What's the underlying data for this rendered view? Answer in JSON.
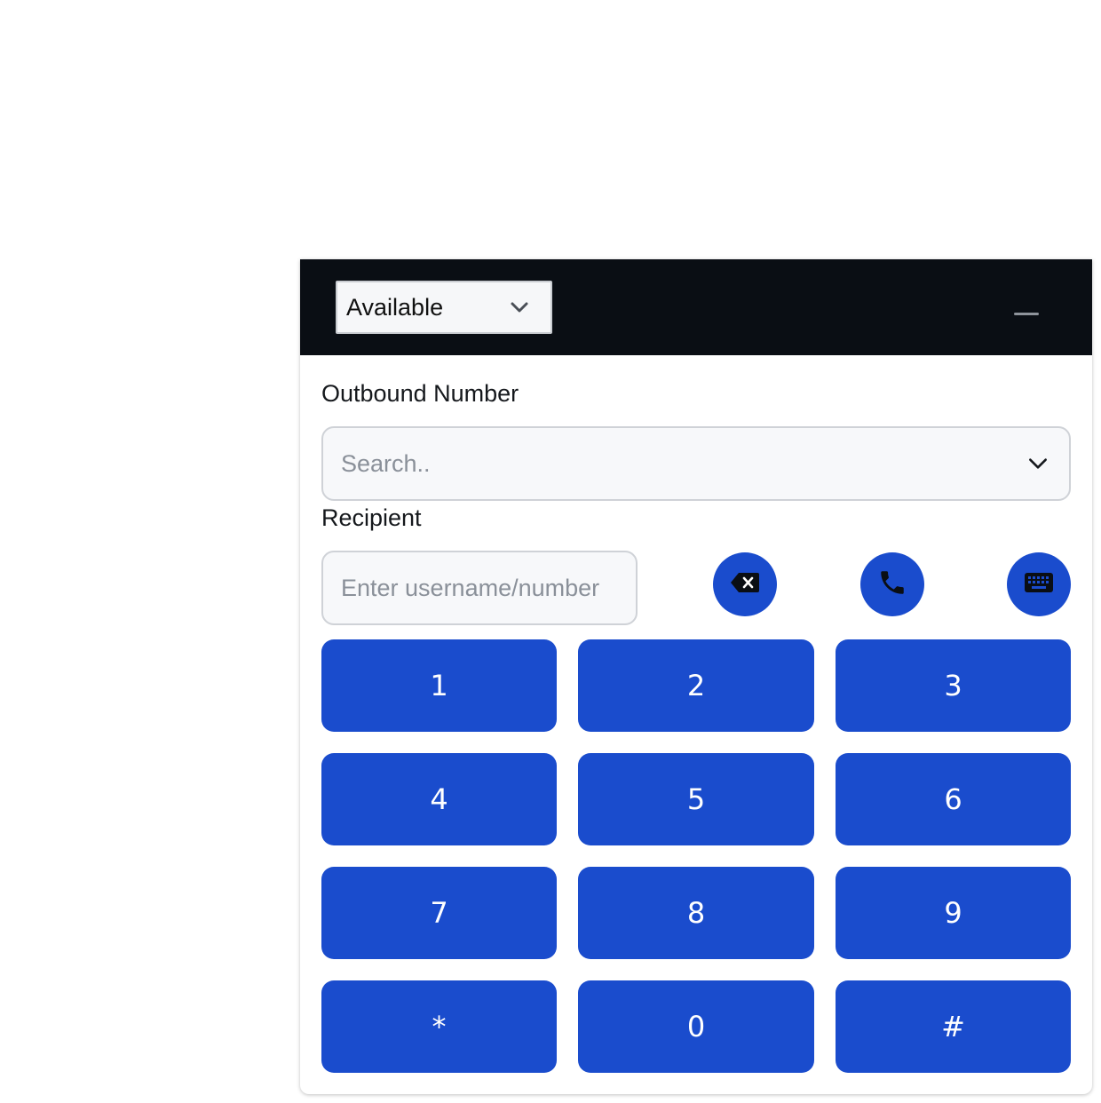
{
  "header": {
    "status_value": "Available",
    "status_chevron_icon": "chevron-down-icon",
    "minimize_icon": "minimize-icon",
    "background": "#0a0e14"
  },
  "outbound": {
    "label": "Outbound Number",
    "placeholder": "Search.."
  },
  "recipient": {
    "label": "Recipient",
    "placeholder": "Enter username/number"
  },
  "actions": {
    "backspace_icon": "backspace-icon",
    "call_icon": "phone-icon",
    "keyboard_icon": "keyboard-icon"
  },
  "keypad": {
    "keys": [
      "1",
      "2",
      "3",
      "4",
      "5",
      "6",
      "7",
      "8",
      "9",
      "*",
      "0",
      "#"
    ]
  },
  "colors": {
    "accent": "#1a4ccd",
    "text": "#15181c",
    "placeholder": "#8a9099"
  }
}
